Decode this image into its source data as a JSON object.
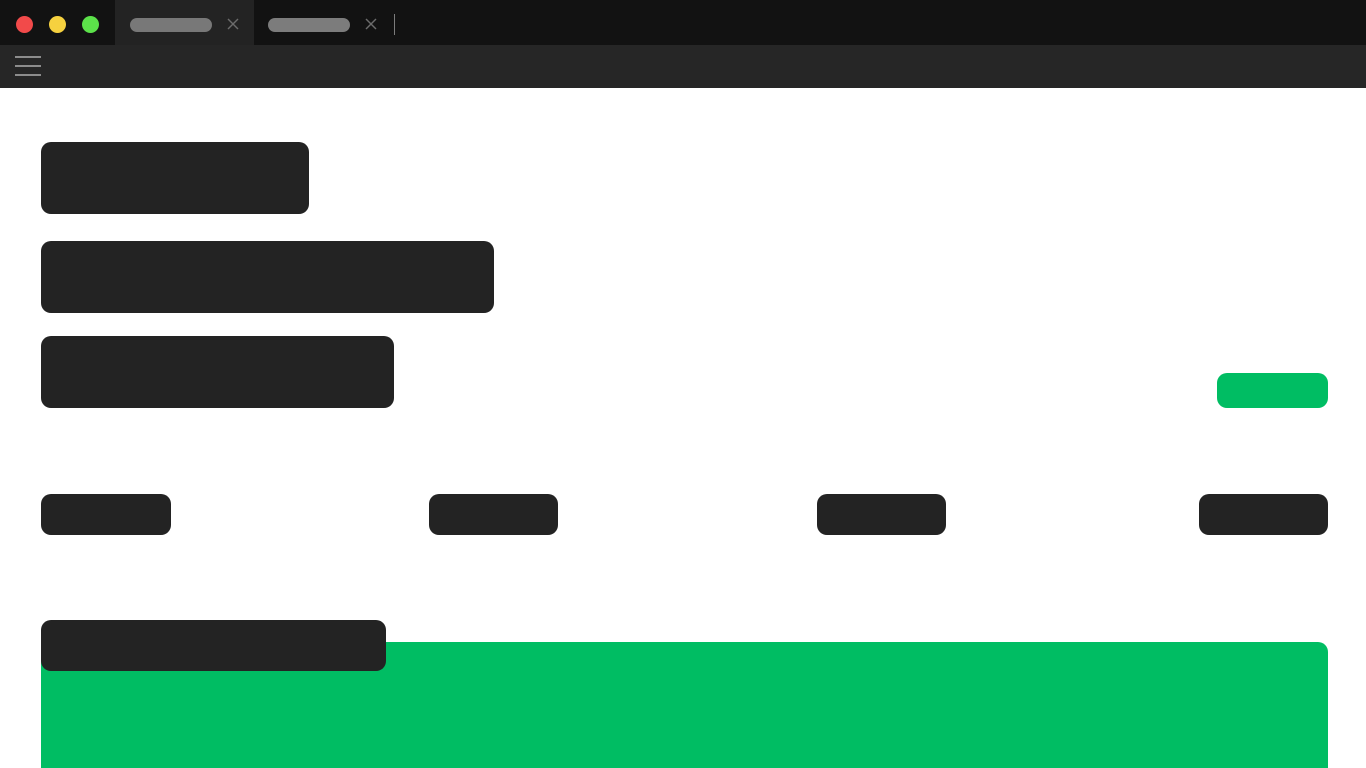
{
  "window": {
    "controls": [
      "close",
      "minimize",
      "maximize"
    ],
    "colors": {
      "close": "#f24a4a",
      "minimize": "#f6d13f",
      "maximize": "#5ce24a"
    }
  },
  "tabs": [
    {
      "label": "",
      "active": true
    },
    {
      "label": "",
      "active": false
    }
  ],
  "toolbar": {
    "menu_icon": "hamburger-menu-icon"
  },
  "content": {
    "headings": [
      "",
      "",
      ""
    ],
    "action_button_label": "",
    "stats": [
      "",
      "",
      "",
      ""
    ],
    "section_title": "",
    "accent_color": "#00bd63",
    "text_block_color": "#232323"
  }
}
